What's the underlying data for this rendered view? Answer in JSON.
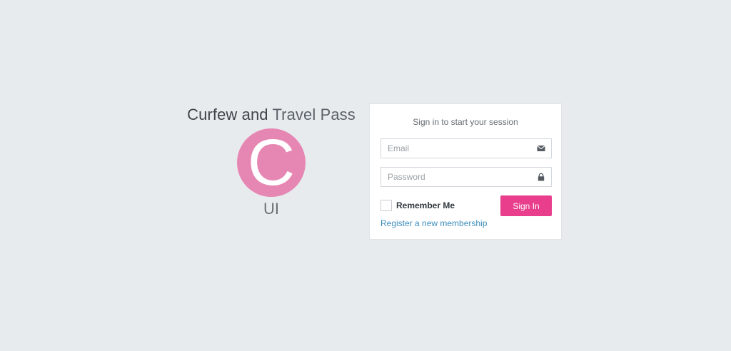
{
  "brand": {
    "title_bold": "Curfew and",
    "title_light": "Travel Pass",
    "logo_letter": "C",
    "logo_color": "#e687b3",
    "subtitle": "UI"
  },
  "login": {
    "message": "Sign in to start your session",
    "email": {
      "placeholder": "Email",
      "value": "",
      "icon": "envelope-icon"
    },
    "password": {
      "placeholder": "Password",
      "value": "",
      "icon": "lock-icon"
    },
    "remember_label": "Remember Me",
    "remember_checked": false,
    "signin_label": "Sign In",
    "signin_color": "#e83e8c",
    "register_label": "Register a new membership",
    "link_color": "#3c8dbc"
  }
}
